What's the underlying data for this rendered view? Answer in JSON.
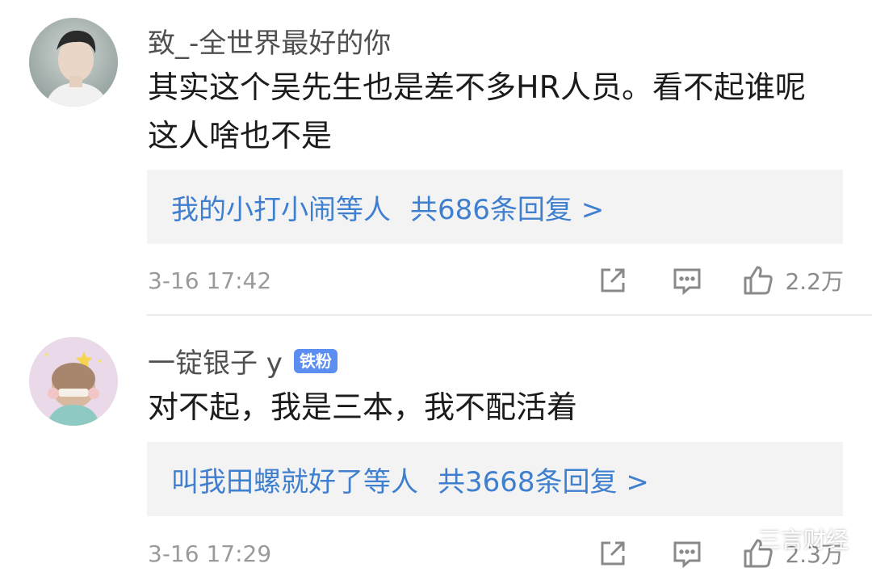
{
  "comments": [
    {
      "username": "致_-全世界最好的你",
      "badge": "",
      "content": "其实这个吴先生也是差不多HR人员。看不起谁呢 这人啥也不是",
      "reply_names": "我的小打小闹",
      "reply_etc": "等人",
      "reply_count": "共686条回复 >",
      "time": "3-16 17:42",
      "likes": "2.2万"
    },
    {
      "username": "一锭银子 y",
      "badge": "铁粉",
      "content": "对不起，我是三本，我不配活着",
      "reply_names": "叫我田螺就好了",
      "reply_etc": "等人",
      "reply_count": "共3668条回复 >",
      "time": "3-16 17:29",
      "likes": "2.3万"
    }
  ],
  "watermark": "三言财经",
  "colors": {
    "link": "#3f7fd0",
    "badge": "#5b8ef0",
    "reply_bg": "#f3f3f3",
    "meta_text": "#9a9a9a"
  }
}
